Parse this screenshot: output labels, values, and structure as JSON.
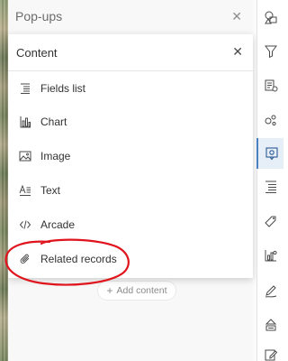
{
  "popups": {
    "title": "Pop-ups",
    "close_icon": "close-icon",
    "add_content_label": "Add content",
    "add_icon": "plus-icon"
  },
  "content_popover": {
    "title": "Content",
    "close_icon": "close-icon",
    "items": [
      {
        "label": "Fields list",
        "icon": "fields-list-icon"
      },
      {
        "label": "Chart",
        "icon": "chart-icon"
      },
      {
        "label": "Image",
        "icon": "image-icon"
      },
      {
        "label": "Text",
        "icon": "text-icon"
      },
      {
        "label": "Arcade",
        "icon": "code-icon"
      },
      {
        "label": "Related records",
        "icon": "paperclip-icon"
      }
    ]
  },
  "toolbar": {
    "items": [
      {
        "icon": "layers-style-icon",
        "active": false
      },
      {
        "icon": "filter-icon",
        "active": false
      },
      {
        "icon": "effects-icon",
        "active": false
      },
      {
        "icon": "clustering-icon",
        "active": false
      },
      {
        "icon": "popup-config-icon",
        "active": true
      },
      {
        "icon": "fields-icon",
        "active": false
      },
      {
        "icon": "labels-icon",
        "active": false
      },
      {
        "icon": "charts-icon",
        "active": false
      },
      {
        "icon": "sketch-icon",
        "active": false
      },
      {
        "icon": "forms-icon",
        "active": false
      },
      {
        "icon": "edit-icon",
        "active": false
      }
    ]
  },
  "annotation_color": "#e0141c",
  "accent_color": "#4a7fc4"
}
